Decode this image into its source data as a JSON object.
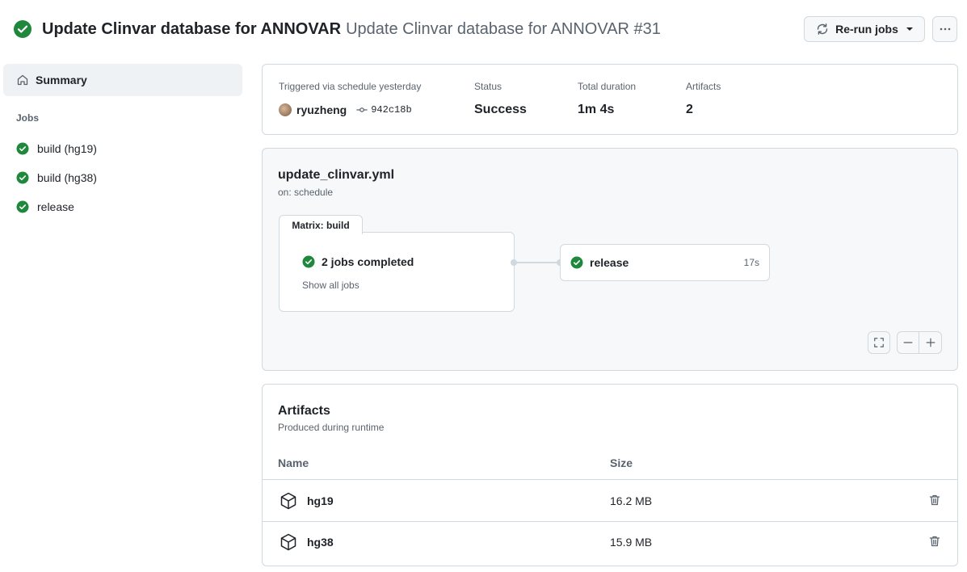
{
  "header": {
    "workflow_title": "Update Clinvar database for ANNOVAR",
    "run_title": "Update Clinvar database for ANNOVAR #31",
    "rerun_label": "Re-run jobs",
    "status_color": "#1f883d"
  },
  "sidebar": {
    "summary_label": "Summary",
    "jobs_heading": "Jobs",
    "jobs": [
      {
        "label": "build (hg19)"
      },
      {
        "label": "build (hg38)"
      },
      {
        "label": "release"
      }
    ]
  },
  "info": {
    "trigger_label": "Triggered via schedule yesterday",
    "user": "ryuzheng",
    "commit": "942c18b",
    "status_label": "Status",
    "status_value": "Success",
    "duration_label": "Total duration",
    "duration_value": "1m 4s",
    "artifacts_label": "Artifacts",
    "artifacts_value": "2"
  },
  "graph": {
    "workflow_file": "update_clinvar.yml",
    "trigger": "on: schedule",
    "matrix_label": "Matrix: build",
    "matrix_status": "2 jobs completed",
    "matrix_link": "Show all jobs",
    "release_job": "release",
    "release_duration": "17s"
  },
  "artifacts": {
    "title": "Artifacts",
    "subtitle": "Produced during runtime",
    "col_name": "Name",
    "col_size": "Size",
    "rows": [
      {
        "name": "hg19",
        "size": "16.2 MB"
      },
      {
        "name": "hg38",
        "size": "15.9 MB"
      }
    ]
  }
}
